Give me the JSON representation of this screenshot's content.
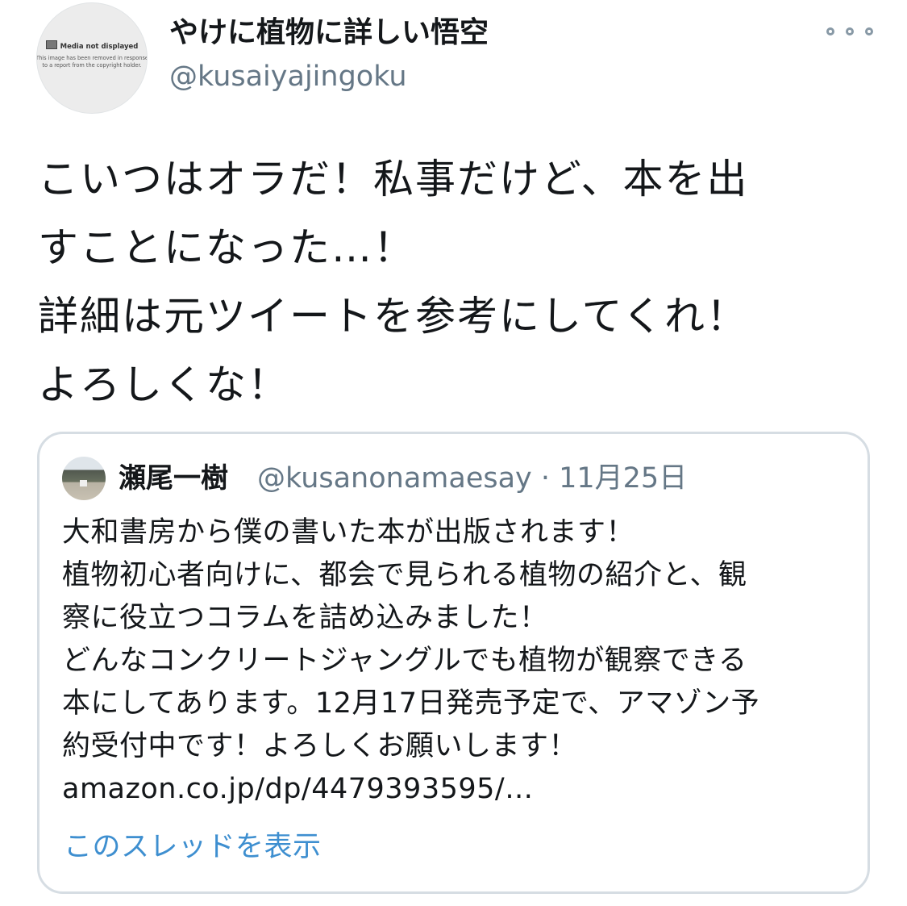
{
  "author": {
    "avatar_title": "Media not displayed",
    "avatar_desc": "This image has been removed in response to a report from the copyright holder.",
    "display_name": "やけに植物に詳しい悟空",
    "handle": "@kusaiyajingoku"
  },
  "tweet": {
    "lines": [
      "こいつはオラだ！私事だけど、本を出",
      "すことになった…！",
      "詳細は元ツイートを参考にしてくれ！",
      "よろしくな！"
    ]
  },
  "quoted": {
    "name": "瀬尾一樹",
    "meta": "@kusanonamaesay · 11月25日",
    "lines": [
      "大和書房から僕の書いた本が出版されます！",
      "植物初心者向けに、都会で見られる植物の紹介と、観",
      "察に役立つコラムを詰め込みました！",
      "どんなコンクリートジャングルでも植物が観察できる",
      "本にしてあります。12月17日発売予定で、アマゾン予",
      "約受付中です！よろしくお願いします！",
      "amazon.co.jp/dp/4479393595/…"
    ],
    "show_thread": "このスレッドを表示"
  },
  "icons": {
    "more": "more-horizontal-icon"
  },
  "colors": {
    "text": "#14171a",
    "secondary": "#657786",
    "link": "#3e8fd0",
    "border": "#d6dde3"
  }
}
